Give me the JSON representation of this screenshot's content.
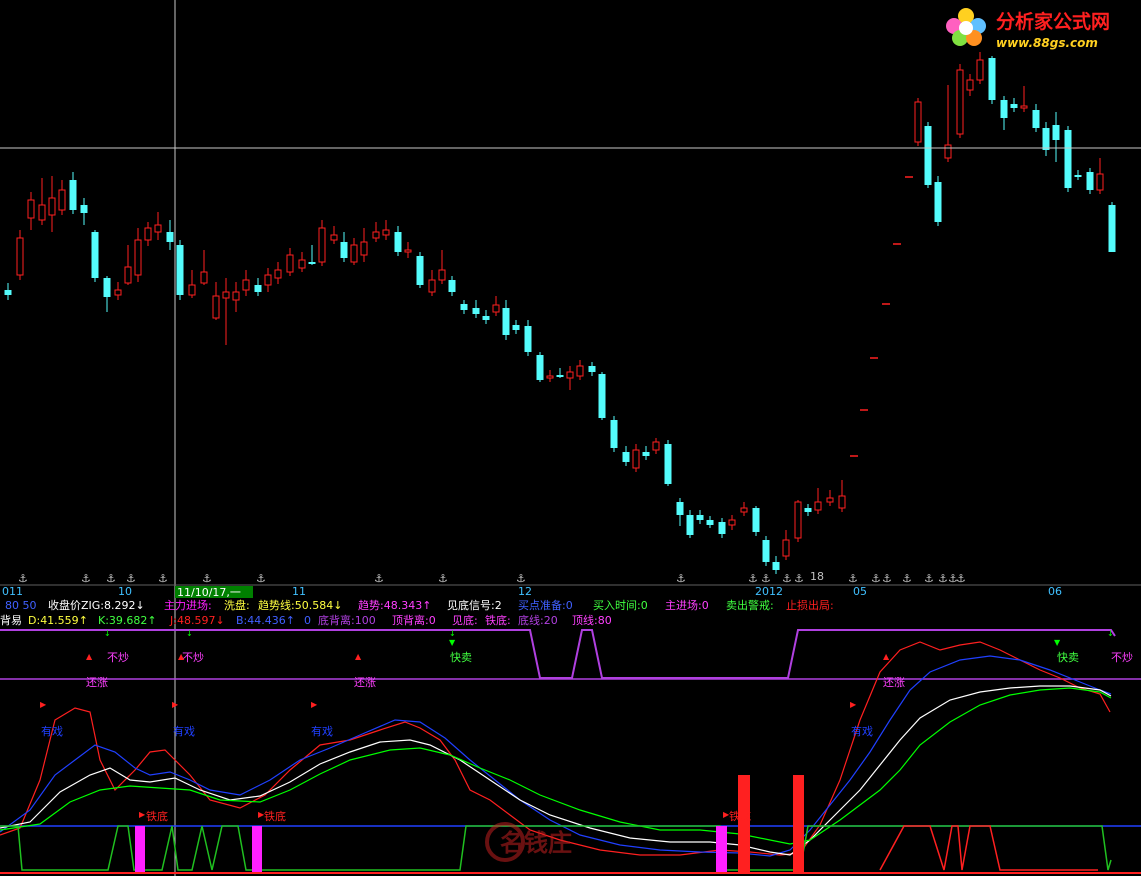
{
  "colors": {
    "background": "#000000",
    "candle_up": "#ff2020",
    "candle_down": "#54fcfc",
    "zig": "#ff2020",
    "crosshair": "#c0c0c0",
    "k_line": "#ffffff",
    "d_line": "#ffff40",
    "j_line": "#00ff00",
    "magenta": "#ff20ff",
    "blue": "#2040ff",
    "red": "#ff2020",
    "green": "#20c020",
    "purple": "#b040e0"
  },
  "watermark": {
    "title": "分析家公式网",
    "url": "www.88gs.com",
    "logo_text": "名钱庄"
  },
  "time_axis": {
    "labels": [
      "011",
      "10",
      "11",
      "12",
      "2012",
      "05",
      "06"
    ],
    "selected_date": "11/10/17,一",
    "marker_value": "18"
  },
  "indicator_row1": {
    "items": [
      {
        "label": "收盘价ZIG:",
        "value": "8.292",
        "arrow": "↓"
      },
      {
        "label": "主力进场:",
        "value": "",
        "arrow": ""
      },
      {
        "label": "洗盘:",
        "value": "",
        "arrow": ""
      },
      {
        "label": "趋势线:",
        "value": "50.584",
        "arrow": "↓"
      },
      {
        "label": "趋势:",
        "value": "48.343",
        "arrow": "↑"
      },
      {
        "label": "见底信号:",
        "value": "2",
        "arrow": ""
      },
      {
        "label": "买点准备:",
        "value": "0",
        "arrow": ""
      },
      {
        "label": "买入时间:",
        "value": "0",
        "arrow": ""
      },
      {
        "label": "主进场:",
        "value": "0",
        "arrow": ""
      },
      {
        "label": "卖出警戒:",
        "value": "",
        "arrow": ""
      },
      {
        "label": "止损出局:",
        "value": "",
        "arrow": ""
      }
    ],
    "prefix": "80  50"
  },
  "indicator_row2": {
    "prefix": "背易",
    "items": [
      {
        "label": "D:",
        "value": "41.559",
        "arrow": "↑"
      },
      {
        "label": "K:",
        "value": "39.682",
        "arrow": "↑"
      },
      {
        "label": "J:",
        "value": "48.597",
        "arrow": "↓"
      },
      {
        "label": "B:",
        "value": "44.436",
        "arrow": "↑"
      },
      {
        "label": "",
        "value": "0",
        "arrow": ""
      },
      {
        "label": "底背离:",
        "value": "100",
        "arrow": ""
      },
      {
        "label": "顶背离:",
        "value": "0",
        "arrow": ""
      },
      {
        "label": "见底:",
        "value": "",
        "arrow": ""
      },
      {
        "label": "铁底:",
        "value": "",
        "arrow": ""
      },
      {
        "label": "底线:",
        "value": "20",
        "arrow": ""
      },
      {
        "label": "顶线:",
        "value": "80",
        "arrow": ""
      }
    ]
  },
  "signals": {
    "bu_chao": "不炒",
    "huan_zhang": "还涨",
    "you_xi": "有戏",
    "kuai_mai": "快卖",
    "tie_di": "铁底"
  }
}
